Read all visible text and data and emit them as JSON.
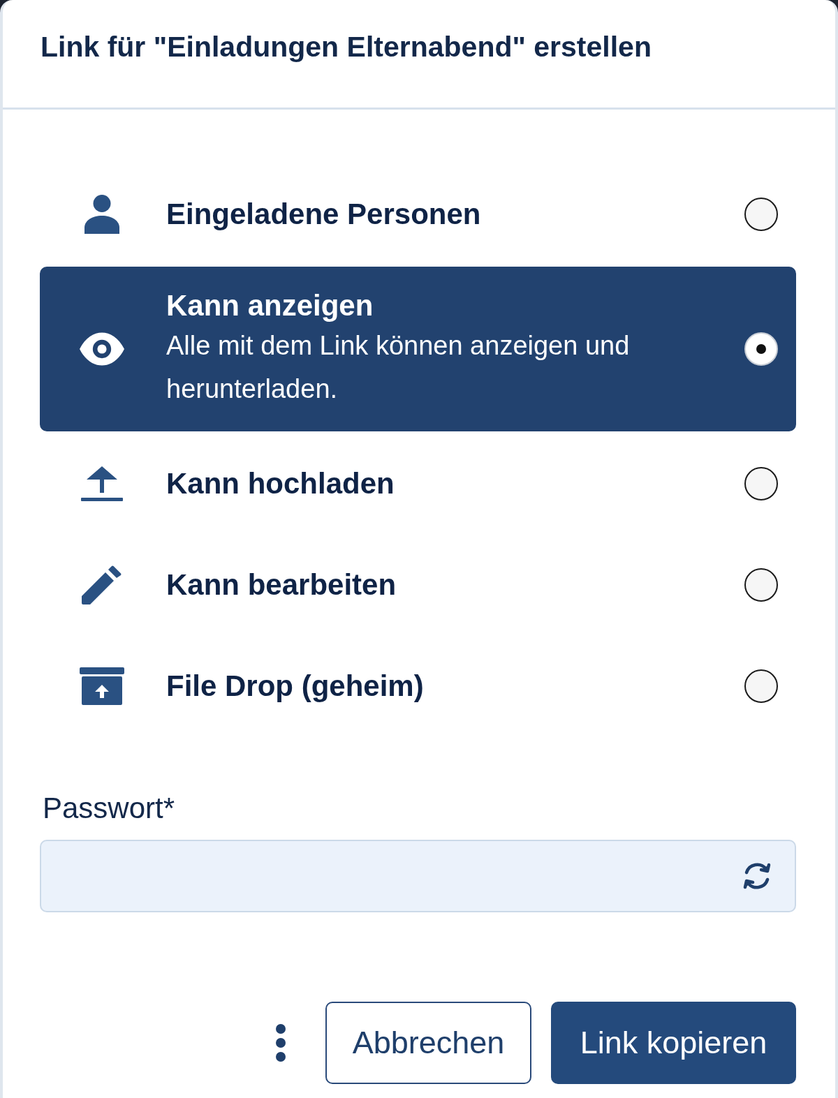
{
  "dialog": {
    "title": "Link für \"Einladungen Elternabend\" erstellen"
  },
  "options": [
    {
      "label": "Eingeladene Personen",
      "selected": false
    },
    {
      "label": "Kann anzeigen",
      "description": "Alle mit dem Link können anzeigen und herunterladen.",
      "selected": true
    },
    {
      "label": "Kann hochladen",
      "selected": false
    },
    {
      "label": "Kann bearbeiten",
      "selected": false
    },
    {
      "label": "File Drop (geheim)",
      "selected": false
    }
  ],
  "password": {
    "label": "Passwort*"
  },
  "footer": {
    "buttons": [
      {
        "kind": "secondary",
        "label": "Abbrechen"
      },
      {
        "kind": "primary",
        "label": "Link kopieren"
      }
    ]
  }
}
